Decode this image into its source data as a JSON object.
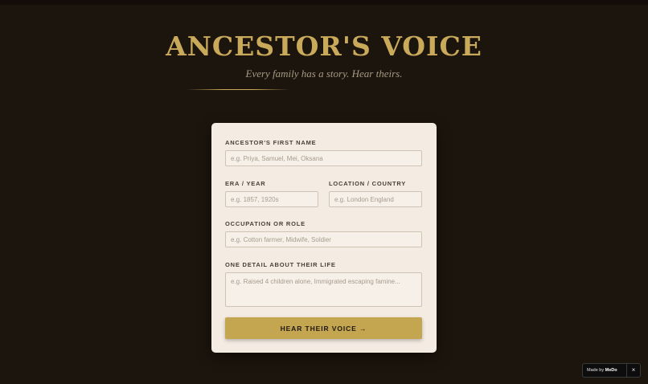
{
  "header": {
    "title": "ANCESTOR'S VOICE",
    "subtitle": "Every family has a story. Hear theirs."
  },
  "form": {
    "first_name": {
      "label": "ANCESTOR'S FIRST NAME",
      "placeholder": "e.g. Priya, Samuel, Mei, Oksana",
      "value": ""
    },
    "era": {
      "label": "ERA / YEAR",
      "placeholder": "e.g. 1857, 1920s",
      "value": ""
    },
    "location": {
      "label": "LOCATION / COUNTRY",
      "placeholder": "e.g. London England",
      "value": ""
    },
    "occupation": {
      "label": "OCCUPATION OR ROLE",
      "placeholder": "e.g. Cotton farmer, Midwife, Soldier",
      "value": ""
    },
    "detail": {
      "label": "ONE DETAIL ABOUT THEIR LIFE",
      "placeholder": "e.g. Raised 4 children alone, Immigrated escaping famine...",
      "value": ""
    },
    "submit_label": "HEAR THEIR VOICE →"
  },
  "badge": {
    "prefix": "Made by",
    "brand": "MeDo",
    "close_icon": "×"
  },
  "colors": {
    "background": "#1c150d",
    "accent": "#c9a95a",
    "card": "#f4ece3",
    "button": "#c4a550"
  }
}
